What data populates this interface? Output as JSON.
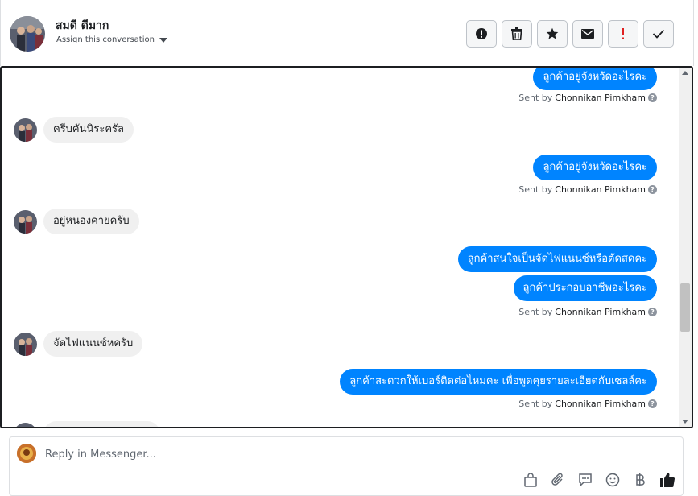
{
  "header": {
    "contact_name": "สมดี ดีมาก",
    "assign_label": "Assign this conversation",
    "actions": [
      {
        "name": "spam-button",
        "icon": "alert-circle-icon"
      },
      {
        "name": "delete-button",
        "icon": "trash-icon"
      },
      {
        "name": "star-button",
        "icon": "star-icon"
      },
      {
        "name": "mark-unread-button",
        "icon": "envelope-icon"
      },
      {
        "name": "important-button",
        "icon": "exclamation-icon"
      },
      {
        "name": "done-button",
        "icon": "checkmark-icon"
      }
    ]
  },
  "messages": [
    {
      "direction": "out",
      "text": "ลูกค้าอยู่จังหวัดอะไรคะ",
      "sent_by_prefix": "Sent by",
      "sender": "Chonnikan Pimkham"
    },
    {
      "direction": "in",
      "text": "ครีบคันนิระครัล"
    },
    {
      "direction": "out",
      "text": "ลูกค้าอยู่จังหวัดอะไรคะ",
      "sent_by_prefix": "Sent by",
      "sender": "Chonnikan Pimkham"
    },
    {
      "direction": "in",
      "text": "อยู่หนองคายครับ"
    },
    {
      "direction": "out",
      "text": "ลูกค้าสนใจเป็นจัดไฟแนนซ์หรือตัดสดคะ"
    },
    {
      "direction": "out",
      "text": "ลูกค้าประกอบอาชีพอะไรคะ",
      "sent_by_prefix": "Sent by",
      "sender": "Chonnikan Pimkham"
    },
    {
      "direction": "in",
      "text": "จัดไฟแนนซ์หครับ"
    },
    {
      "direction": "out",
      "text": "ลูกค้าสะดวกให้เบอร์ติดต่อไหมคะ เพื่อพูดคุยรายละเอียดกับเซลล์คะ",
      "sent_by_prefix": "Sent by",
      "sender": "Chonnikan Pimkham"
    }
  ],
  "composer": {
    "placeholder": "Reply in Messenger...",
    "tools": [
      "bag-icon",
      "paperclip-icon",
      "saved-reply-icon",
      "emoji-icon",
      "baht-icon",
      "thumbs-up-icon"
    ]
  },
  "colors": {
    "outgoing_bubble": "#0084ff",
    "incoming_bubble": "#f0f0f0",
    "important": "#e02020"
  }
}
